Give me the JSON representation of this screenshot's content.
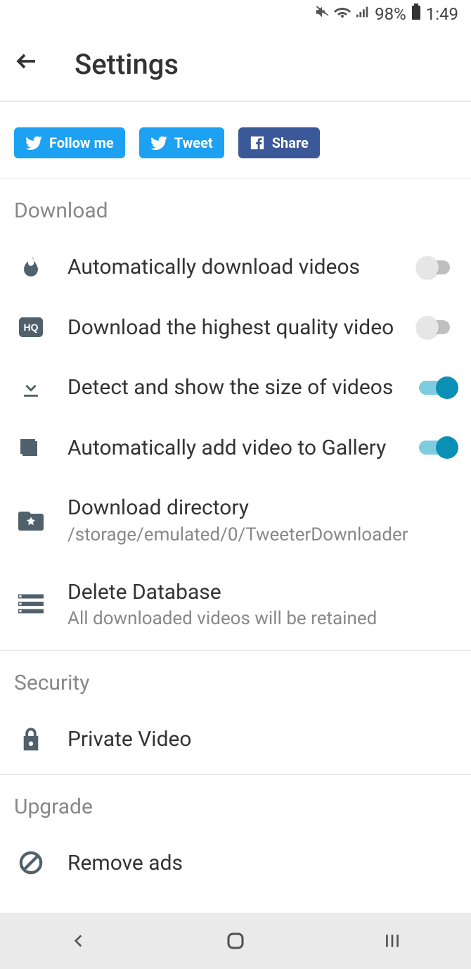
{
  "statusbar": {
    "battery": "98%",
    "time": "1:49"
  },
  "header": {
    "title": "Settings"
  },
  "social": {
    "follow": "Follow me",
    "tweet": "Tweet",
    "share": "Share"
  },
  "sections": {
    "download": {
      "header": "Download",
      "auto_download": "Automatically download videos",
      "highest_quality": "Download the highest quality video",
      "detect_size": "Detect and show the size of videos",
      "auto_gallery": "Automatically add video to Gallery",
      "download_dir_title": "Download directory",
      "download_dir_sub": "/storage/emulated/0/TweeterDownloader",
      "delete_db_title": "Delete Database",
      "delete_db_sub": "All downloaded videos will be retained"
    },
    "security": {
      "header": "Security",
      "private_video": "Private Video"
    },
    "upgrade": {
      "header": "Upgrade",
      "remove_ads": "Remove ads"
    }
  }
}
